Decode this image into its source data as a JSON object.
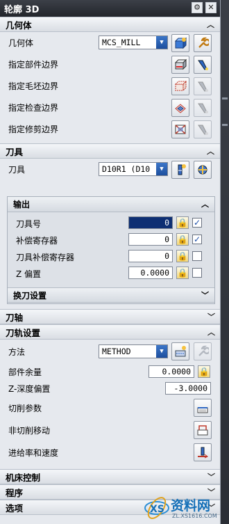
{
  "window": {
    "title": "轮廓 3D",
    "gear_icon": "gear-icon",
    "close_icon": "close-icon"
  },
  "geometry": {
    "header": "几何体",
    "geometry_label": "几何体",
    "geometry_value": "MCS_MILL",
    "part_boundary_label": "指定部件边界",
    "blank_boundary_label": "指定毛坯边界",
    "check_boundary_label": "指定检查边界",
    "trim_boundary_label": "指定修剪边界"
  },
  "tool": {
    "header": "刀具",
    "tool_label": "刀具",
    "tool_value": "D10R1 (D10",
    "output": {
      "header": "输出",
      "tool_number_label": "刀具号",
      "tool_number_value": "0",
      "comp_register_label": "补偿寄存器",
      "comp_register_value": "0",
      "tool_comp_register_label": "刀具补偿寄存器",
      "tool_comp_register_value": "0",
      "z_offset_label": "Z 偏置",
      "z_offset_value": "0.0000"
    },
    "tool_change_header": "换刀设置"
  },
  "tool_axis": {
    "header": "刀轴"
  },
  "path_settings": {
    "header": "刀轨设置",
    "method_label": "方法",
    "method_value": "METHOD",
    "stock_label": "部件余量",
    "stock_value": "0.0000",
    "z_depth_label": "Z-深度偏置",
    "z_depth_value": "-3.0000",
    "cutting_params_label": "切削参数",
    "non_cutting_label": "非切削移动",
    "feeds_speeds_label": "进给率和速度"
  },
  "machine_control": {
    "header": "机床控制"
  },
  "program": {
    "header": "程序"
  },
  "options": {
    "header": "选项"
  },
  "watermark": {
    "brand": "资料网",
    "url": "ZL.XS1616.COM"
  },
  "colors": {
    "accent": "#1d4f9e",
    "selection": "#0e2f73",
    "titlebar": "#22252b"
  }
}
